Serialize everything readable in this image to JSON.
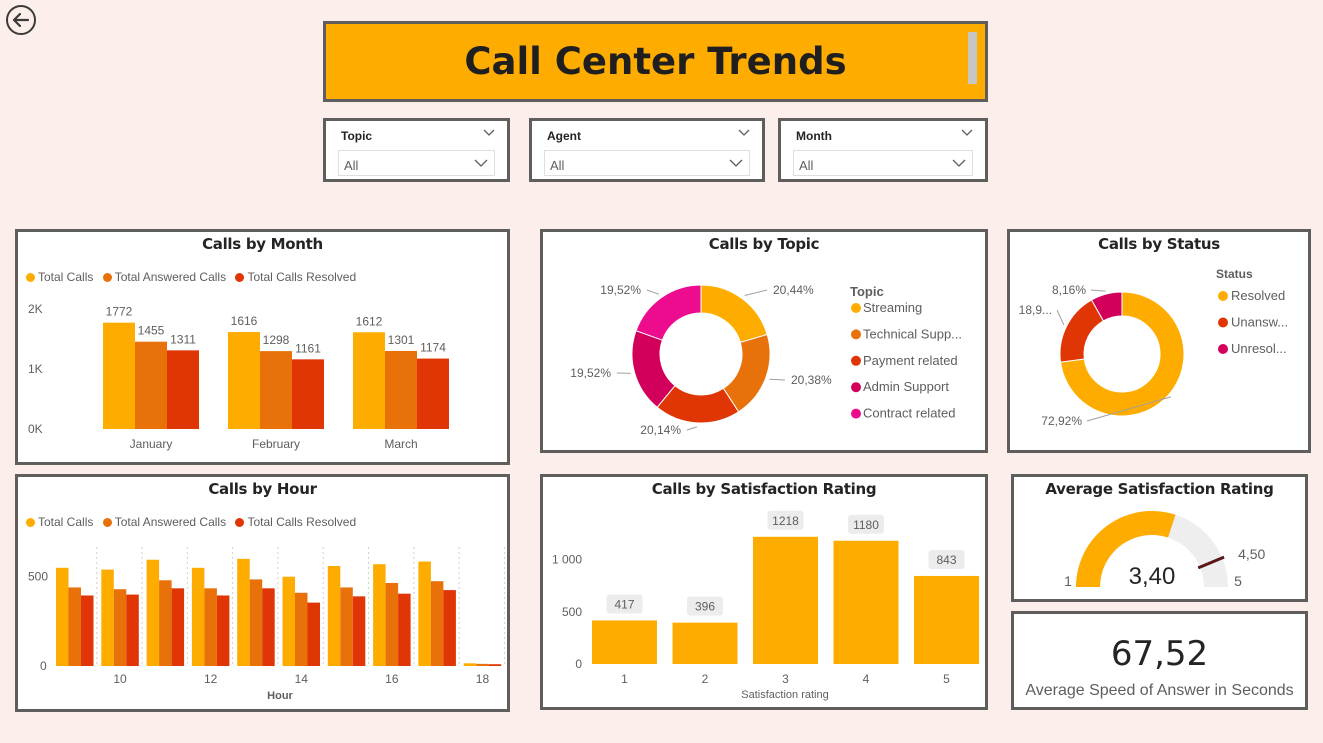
{
  "header": {
    "title": "Call Center Trends"
  },
  "slicers": [
    {
      "label": "Topic",
      "value": "All"
    },
    {
      "label": "Agent",
      "value": "All"
    },
    {
      "label": "Month",
      "value": "All"
    }
  ],
  "colors": {
    "total_calls": "#ffac00",
    "answered": "#e8710a",
    "resolved": "#e03505",
    "admin": "#d2005a",
    "contract": "#ee0c8e",
    "gauge_track": "#eeeeee",
    "target": "#5b1616"
  },
  "legend_labels": [
    "Total Calls",
    "Total Answered Calls",
    "Total Calls Resolved"
  ],
  "calls_by_month": {
    "title": "Calls by Month",
    "chart_data": {
      "type": "bar",
      "categories": [
        "January",
        "February",
        "March"
      ],
      "series": [
        {
          "name": "Total Calls",
          "values": [
            1772,
            1616,
            1612
          ]
        },
        {
          "name": "Total Answered Calls",
          "values": [
            1455,
            1298,
            1301
          ]
        },
        {
          "name": "Total Calls Resolved",
          "values": [
            1311,
            1161,
            1174
          ]
        }
      ],
      "y_ticks": [
        "2K",
        "1K",
        "0K"
      ],
      "ylim": [
        0,
        2000
      ],
      "legend": "top-left"
    }
  },
  "calls_by_hour": {
    "title": "Calls by Hour",
    "chart_data": {
      "type": "bar",
      "x": [
        9,
        10,
        11,
        12,
        13,
        14,
        15,
        16,
        17,
        18
      ],
      "x_tick_labels": [
        "10",
        "12",
        "14",
        "16",
        "18"
      ],
      "xlabel": "Hour",
      "series": [
        {
          "name": "Total Calls",
          "values": [
            550,
            540,
            595,
            550,
            600,
            500,
            560,
            570,
            585,
            15
          ]
        },
        {
          "name": "Total Answered Calls",
          "values": [
            440,
            430,
            480,
            435,
            485,
            410,
            440,
            465,
            475,
            12
          ]
        },
        {
          "name": "Total Calls Resolved",
          "values": [
            395,
            400,
            435,
            395,
            435,
            355,
            390,
            405,
            425,
            10
          ]
        }
      ],
      "y_ticks": [
        "500",
        "0"
      ],
      "ylim": [
        0,
        700
      ],
      "legend": "top-left"
    }
  },
  "calls_by_topic": {
    "title": "Calls by Topic",
    "legend_title": "Topic",
    "chart_data": {
      "type": "pie",
      "donut": true,
      "categories": [
        "Streaming",
        "Technical Supp...",
        "Payment related",
        "Admin Support",
        "Contract related"
      ],
      "values": [
        20.44,
        20.38,
        20.14,
        19.52,
        19.52
      ],
      "data_labels": [
        "20,44%",
        "20,38%",
        "20,14%",
        "19,52%",
        "19,52%"
      ],
      "legend": "right"
    }
  },
  "calls_by_status": {
    "title": "Calls by Status",
    "legend_title": "Status",
    "chart_data": {
      "type": "pie",
      "donut": true,
      "categories": [
        "Resolved",
        "Unansw...",
        "Unresol..."
      ],
      "values": [
        72.92,
        18.92,
        8.16
      ],
      "data_labels": [
        "72,92%",
        "18,9...",
        "8,16%"
      ],
      "legend": "right"
    }
  },
  "calls_by_satisfaction": {
    "title": "Calls by Satisfaction Rating",
    "chart_data": {
      "type": "bar",
      "categories": [
        "1",
        "2",
        "3",
        "4",
        "5"
      ],
      "values": [
        417,
        396,
        1218,
        1180,
        843
      ],
      "xlabel": "Satisfaction rating",
      "y_ticks": [
        "1 000",
        "500",
        "0"
      ],
      "ylim": [
        0,
        1400
      ]
    }
  },
  "avg_satisfaction": {
    "title": "Average Satisfaction Rating",
    "value": 3.4,
    "value_label": "3,40",
    "min_label": "1",
    "max_label": "5",
    "target_label": "4,50",
    "min": 1,
    "max": 5,
    "target": 4.5
  },
  "avg_speed": {
    "value": "67,52",
    "caption": "Average Speed of Answer in Seconds"
  }
}
